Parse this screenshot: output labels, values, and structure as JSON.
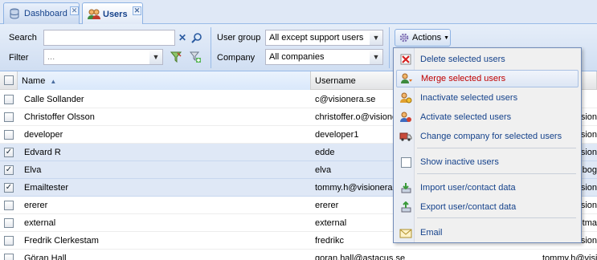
{
  "tabs": [
    {
      "label": "Dashboard",
      "close": "✕"
    },
    {
      "label": "Users",
      "close": "✕"
    }
  ],
  "toolbar": {
    "search_label": "Search",
    "search_value": "",
    "filter_label": "Filter",
    "filter_placeholder": "...",
    "user_group_label": "User group",
    "user_group_value": "All except support users",
    "company_label": "Company",
    "company_value": "All companies",
    "actions_label": "Actions",
    "clear_icon": "✕",
    "search_icon": "⌕"
  },
  "grid": {
    "columns": [
      "Name",
      "Username"
    ],
    "rows": [
      {
        "name": "Calle Sollander",
        "username": "c@visionera.se",
        "extra": "",
        "checked": false
      },
      {
        "name": "Christoffer Olsson",
        "username": "christoffer.o@visionera.se",
        "extra": "ision",
        "checked": false
      },
      {
        "name": "developer",
        "username": "developer1",
        "extra": "ision",
        "checked": false
      },
      {
        "name": "Edvard R",
        "username": "edde",
        "extra": "ision",
        "checked": true
      },
      {
        "name": "Elva",
        "username": "elva",
        "extra": "s.bog",
        "checked": true
      },
      {
        "name": "Emailtester",
        "username": "tommy.h@visionera.se",
        "extra": "ision",
        "checked": true
      },
      {
        "name": "ererer",
        "username": "ererer",
        "extra": "ision",
        "checked": false
      },
      {
        "name": "external",
        "username": "external",
        "extra": "otma",
        "checked": false
      },
      {
        "name": "Fredrik Clerkestam",
        "username": "fredrikc",
        "extra": "ision",
        "checked": false
      },
      {
        "name": "Göran Hall",
        "username": "goran.hall@astacus.se",
        "extra": "tommy.h@visiona",
        "checked": false
      }
    ]
  },
  "menu": {
    "items": [
      {
        "label": "Delete selected users",
        "icon": "delete-icon"
      },
      {
        "label": "Merge selected users",
        "icon": "merge-icon"
      },
      {
        "label": "Inactivate selected users",
        "icon": "inactivate-icon"
      },
      {
        "label": "Activate selected users",
        "icon": "activate-icon"
      },
      {
        "label": "Change company for selected users",
        "icon": "truck-icon"
      },
      {
        "label": "Show inactive users",
        "icon": "checkbox-icon"
      },
      {
        "label": "Import user/contact data",
        "icon": "import-icon"
      },
      {
        "label": "Export user/contact data",
        "icon": "export-icon"
      },
      {
        "label": "Email",
        "icon": "email-icon"
      }
    ],
    "highlighted": "Merge selected users"
  },
  "colors": {
    "accent": "#15428b",
    "selected_row": "#dfe8f6",
    "menu_highlight_text": "#c00000"
  }
}
